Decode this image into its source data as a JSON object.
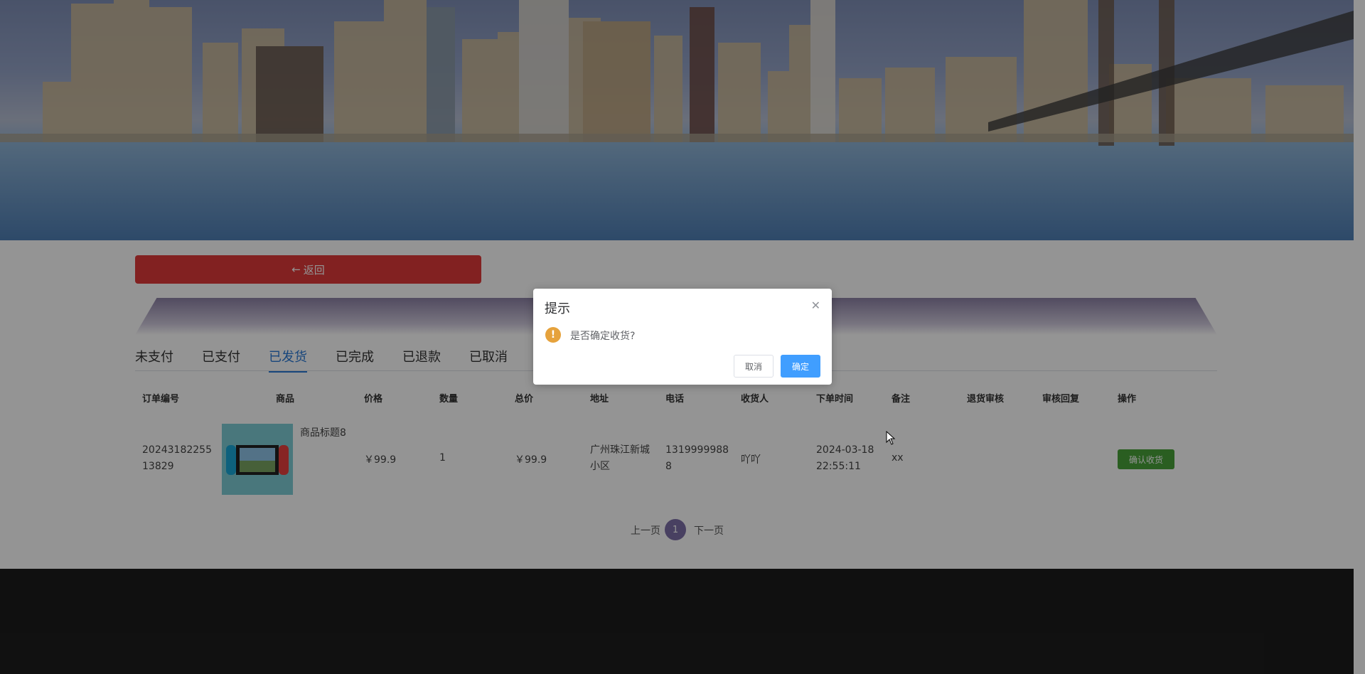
{
  "page": {
    "back_label": "返回",
    "tabs": [
      "未支付",
      "已支付",
      "已发货",
      "已完成",
      "已退款",
      "已取消"
    ],
    "active_tab": "已发货",
    "table": {
      "headers": [
        "订单编号",
        "商品",
        "价格",
        "数量",
        "总价",
        "地址",
        "电话",
        "收货人",
        "下单时间",
        "备注",
        "退货审核",
        "审核回复",
        "操作"
      ],
      "rows": [
        {
          "order_no": "2024318225513829",
          "product_title": "商品标题8",
          "price": "￥99.9",
          "quantity": "1",
          "total": "￥99.9",
          "address": "广州珠江新城小区",
          "phone": "13199999888",
          "receiver": "吖吖",
          "order_time": "2024-03-18 22:55:11",
          "remark": "xx",
          "return_review": "",
          "review_reply": "",
          "action_label": "确认收货"
        }
      ]
    },
    "pager": {
      "prev": "上一页",
      "current": "1",
      "next": "下一页"
    }
  },
  "dialog": {
    "title": "提示",
    "message": "是否确定收货?",
    "cancel_label": "取消",
    "ok_label": "确定",
    "icon": "warning-icon"
  },
  "colors": {
    "back_button": "#e03a3a",
    "active_tab": "#2a79d6",
    "confirm_button": "#49a33a",
    "ok_button": "#409eff",
    "warning": "#e6a23c",
    "page_current": "#7d6ea8",
    "footer": "#1d1d1d"
  }
}
